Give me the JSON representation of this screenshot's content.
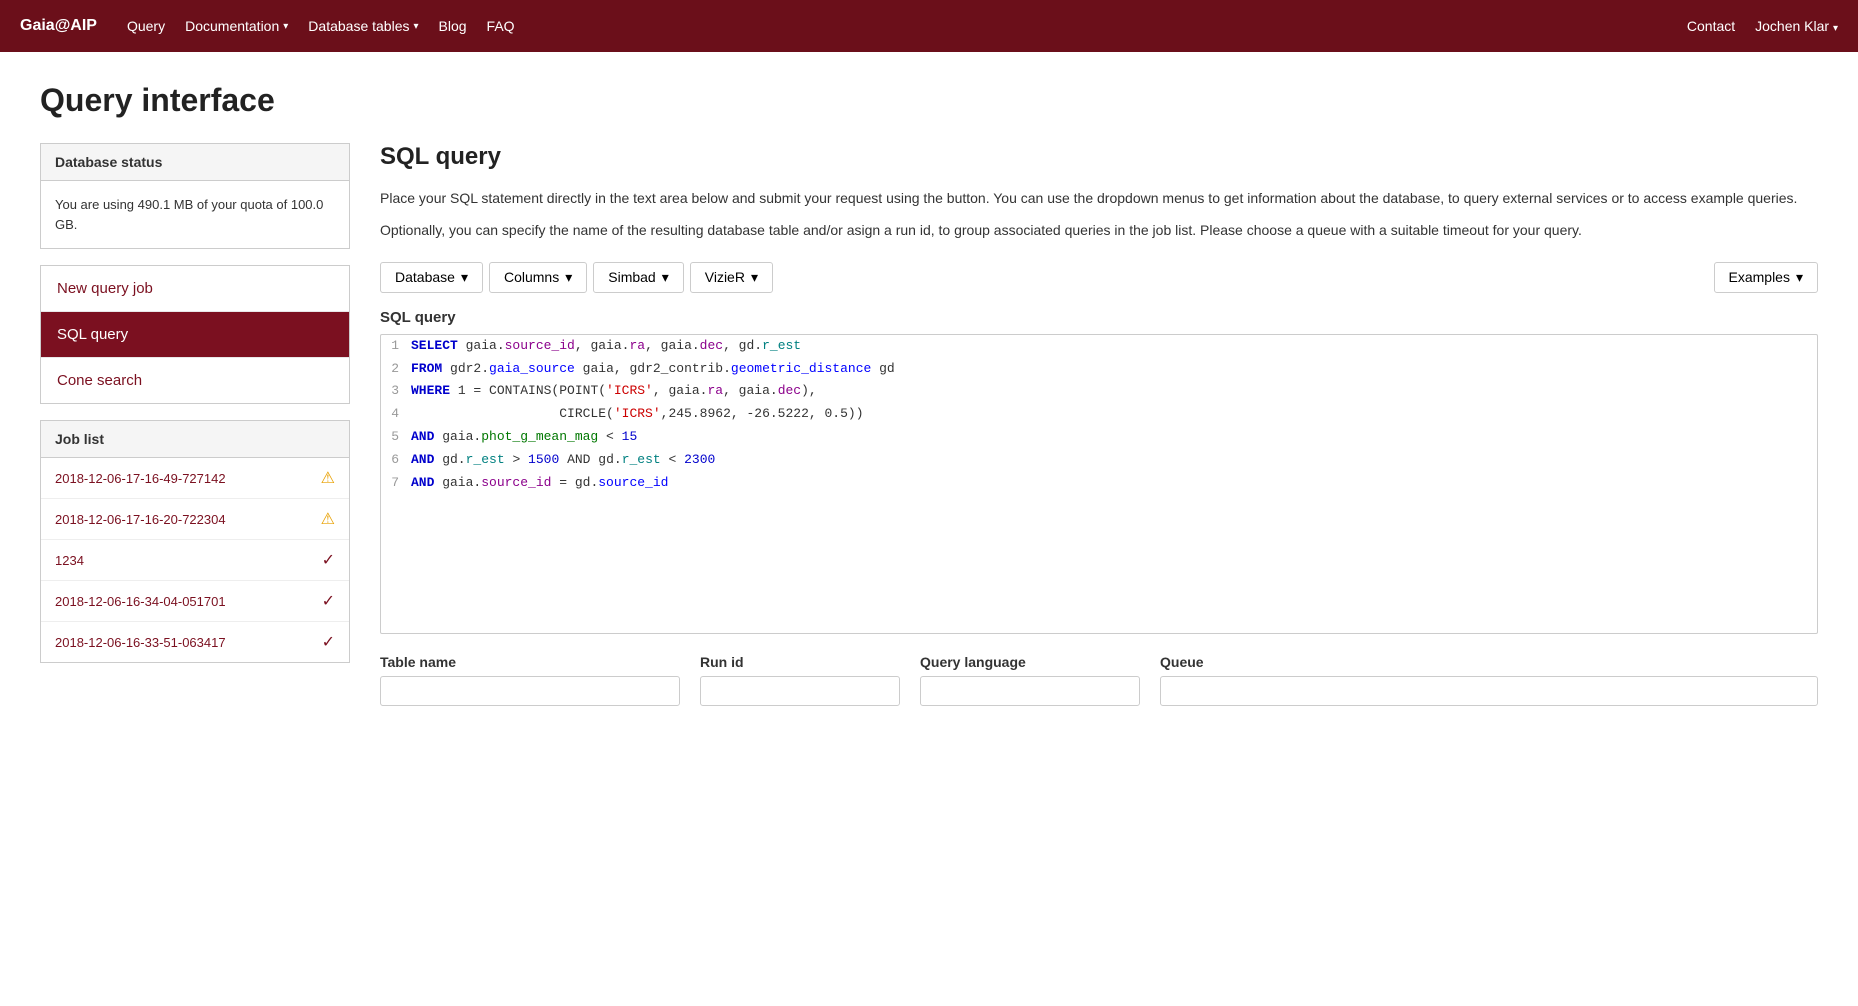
{
  "nav": {
    "brand": "Gaia@AIP",
    "links": [
      {
        "label": "Query",
        "dropdown": false
      },
      {
        "label": "Documentation",
        "dropdown": true
      },
      {
        "label": "Database tables",
        "dropdown": true
      },
      {
        "label": "Blog",
        "dropdown": false
      },
      {
        "label": "FAQ",
        "dropdown": false
      }
    ],
    "right_links": [
      {
        "label": "Contact"
      },
      {
        "label": "Jochen Klar",
        "dropdown": true
      }
    ]
  },
  "page": {
    "title": "Query interface"
  },
  "sidebar": {
    "db_status_header": "Database status",
    "db_status_body": "You are using 490.1 MB of your quota of 100.0 GB.",
    "nav_items": [
      {
        "label": "New query job",
        "active": false,
        "link": false
      },
      {
        "label": "SQL query",
        "active": true,
        "link": false
      },
      {
        "label": "Cone search",
        "active": false,
        "link": true
      }
    ],
    "job_list_header": "Job list",
    "jobs": [
      {
        "id": "2018-12-06-17-16-49-727142",
        "icon": "warning"
      },
      {
        "id": "2018-12-06-17-16-20-722304",
        "icon": "warning"
      },
      {
        "id": "1234",
        "icon": "check"
      },
      {
        "id": "2018-12-06-16-34-04-051701",
        "icon": "check"
      },
      {
        "id": "2018-12-06-16-33-51-063417",
        "icon": "check"
      }
    ]
  },
  "main": {
    "section_title": "SQL query",
    "description_1": "Place your SQL statement directly in the text area below and submit your request using the button. You can use the dropdown menus to get information about the database, to query external services or to access example queries.",
    "description_2": "Optionally, you can specify the name of the resulting database table and/or asign a run id, to group associated queries in the job list. Please choose a queue with a suitable timeout for your query.",
    "toolbar_buttons": [
      {
        "label": "Database",
        "dropdown": true
      },
      {
        "label": "Columns",
        "dropdown": true
      },
      {
        "label": "Simbad",
        "dropdown": true
      },
      {
        "label": "VizieR",
        "dropdown": true
      }
    ],
    "examples_button": "Examples",
    "query_label": "SQL query",
    "code_lines": [
      {
        "num": 1,
        "parts": [
          {
            "text": "SELECT",
            "class": "kw-select"
          },
          {
            "text": " gaia.",
            "class": ""
          },
          {
            "text": "source_id",
            "class": "col-purple"
          },
          {
            "text": ", gaia.",
            "class": ""
          },
          {
            "text": "ra",
            "class": "col-purple"
          },
          {
            "text": ", gaia.",
            "class": ""
          },
          {
            "text": "dec",
            "class": "col-purple"
          },
          {
            "text": ", gd.",
            "class": ""
          },
          {
            "text": "r_est",
            "class": "col-teal"
          }
        ]
      },
      {
        "num": 2,
        "parts": [
          {
            "text": "FROM",
            "class": "kw-from"
          },
          {
            "text": " gdr2.",
            "class": ""
          },
          {
            "text": "gaia_source",
            "class": "col-blue"
          },
          {
            "text": " gaia, gdr2_contrib.",
            "class": ""
          },
          {
            "text": "geometric_distance",
            "class": "col-blue"
          },
          {
            "text": " gd",
            "class": ""
          }
        ]
      },
      {
        "num": 3,
        "parts": [
          {
            "text": "WHERE",
            "class": "kw-where"
          },
          {
            "text": " 1 = CONTAINS(POINT(",
            "class": ""
          },
          {
            "text": "'ICRS'",
            "class": "str-red"
          },
          {
            "text": ", gaia.",
            "class": ""
          },
          {
            "text": "ra",
            "class": "col-purple"
          },
          {
            "text": ", gaia.",
            "class": ""
          },
          {
            "text": "dec",
            "class": "col-purple"
          },
          {
            "text": "),",
            "class": ""
          }
        ]
      },
      {
        "num": 4,
        "parts": [
          {
            "text": "                   CIRCLE(",
            "class": ""
          },
          {
            "text": "'ICRS'",
            "class": "str-red"
          },
          {
            "text": ",245.8962, -26.5222, 0.5))",
            "class": ""
          }
        ]
      },
      {
        "num": 5,
        "parts": [
          {
            "text": "AND",
            "class": "kw-and"
          },
          {
            "text": " gaia.",
            "class": ""
          },
          {
            "text": "phot_g_mean_mag",
            "class": "col-green"
          },
          {
            "text": " < ",
            "class": ""
          },
          {
            "text": "15",
            "class": "num-blue"
          }
        ]
      },
      {
        "num": 6,
        "parts": [
          {
            "text": "AND",
            "class": "kw-and"
          },
          {
            "text": " gd.",
            "class": ""
          },
          {
            "text": "r_est",
            "class": "col-teal"
          },
          {
            "text": " > ",
            "class": ""
          },
          {
            "text": "1500",
            "class": "num-blue"
          },
          {
            "text": " AND gd.",
            "class": ""
          },
          {
            "text": "r_est",
            "class": "col-teal"
          },
          {
            "text": " < ",
            "class": ""
          },
          {
            "text": "2300",
            "class": "num-blue"
          }
        ]
      },
      {
        "num": 7,
        "parts": [
          {
            "text": "AND",
            "class": "kw-and"
          },
          {
            "text": " gaia.",
            "class": ""
          },
          {
            "text": "source_id",
            "class": "col-purple"
          },
          {
            "text": " = gd.",
            "class": ""
          },
          {
            "text": "source_id",
            "class": "col-blue"
          }
        ]
      }
    ],
    "form": {
      "table_name_label": "Table name",
      "table_name_placeholder": "",
      "run_id_label": "Run id",
      "run_id_placeholder": "",
      "query_language_label": "Query language",
      "queue_label": "Queue"
    }
  }
}
